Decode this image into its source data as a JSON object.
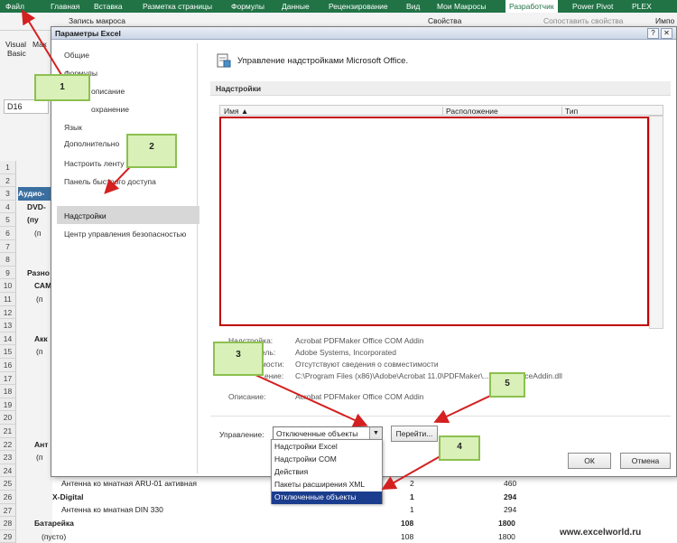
{
  "ribbon": {
    "tabs": [
      "Файл",
      "Главная",
      "Вставка",
      "Разметка страницы",
      "Формулы",
      "Данные",
      "Рецензирование",
      "Вид",
      "Мои Макросы",
      "Разработчик",
      "Power Pivot",
      "PLEX"
    ],
    "record_macro": "Запись макроса",
    "properties": "Свойства",
    "map_properties": "Сопоставить свойства",
    "import": "Импо",
    "vb_line1": "Visual",
    "vb_line2": "Basic",
    "macros": "Мак"
  },
  "sheet": {
    "name_box": "D16",
    "row_numbers": [
      "1",
      "2",
      "3",
      "4",
      "5",
      "6",
      "7",
      "8",
      "9",
      "10",
      "11",
      "12",
      "13",
      "14",
      "15",
      "16",
      "17",
      "18",
      "19",
      "20",
      "21",
      "22",
      "23",
      "24",
      "25",
      "26",
      "27",
      "28",
      "29"
    ],
    "left_labels": [
      "Аудио-",
      "DVD-",
      "(пу",
      "(п",
      "",
      "",
      "",
      "Разно",
      "САМ",
      "(п",
      "",
      "",
      "Акк",
      "(п",
      "",
      "",
      "",
      "",
      "",
      "",
      "Ант",
      "(п",
      "",
      "",
      "",
      "",
      ""
    ],
    "rows": [
      {
        "label": "Антенна ко мнатная  ARU-01 активная",
        "qty": "2",
        "sum": "460"
      },
      {
        "label": "X-Digital",
        "qty": "1",
        "sum": "294"
      },
      {
        "label": "Антенна ко мнатная  DIN 330",
        "qty": "1",
        "sum": "294"
      },
      {
        "label": "Батарейка",
        "qty": "108",
        "sum": "1800"
      },
      {
        "label": "(пусто)",
        "qty": "108",
        "sum": "1800"
      }
    ]
  },
  "dialog": {
    "title": "Параметры Excel",
    "help": "?",
    "close": "✕",
    "nav": [
      "Общие",
      "Формулы",
      "Правописание",
      "Сохранение",
      "Язык",
      "Дополнительно",
      "Настроить ленту",
      "Панель быстрого доступа",
      "Надстройки",
      "Центр управления безопасностью"
    ],
    "nav_shown": [
      "Общие",
      "Формулы",
      "описание",
      "охранение",
      "Язык",
      "Дополнительно",
      "Настроить ленту",
      "Панель быстрого доступа",
      "Надстройки",
      "Центр управления безопасностью"
    ],
    "header_title": "Управление надстройками Microsoft Office.",
    "section_title": "Надстройки",
    "columns": [
      "Имя ▲",
      "Расположение",
      "Тип"
    ],
    "details": {
      "addin_label": "Надстройка:",
      "addin_value": "Acrobat PDFMaker Office COM Addin",
      "publisher_label": "ель:",
      "publisher_value": "Adobe Systems, Incorporated",
      "compat_label": "мости:",
      "compat_value": "Отсутствуют сведения о совместимости",
      "location_label": "ение:",
      "location_value": "C:\\Program Files (x86)\\Adobe\\Acrobat 11.0\\PDFMaker\\...\\PDFMOfficeAddin.dll",
      "description_label": "Описание:",
      "description_value": "Acrobat PDFMaker Office COM Addin"
    },
    "manage_label": "Управление:",
    "manage_value": "Отключенные объекты",
    "go_button": "Перейти...",
    "ok_button": "ОК",
    "cancel_button": "Отмена",
    "dropdown_options": [
      "Надстройки Excel",
      "Надстройки COM",
      "Действия",
      "Пакеты расширения XML",
      "Отключенные объекты"
    ]
  },
  "callouts": [
    "1",
    "2",
    "3",
    "4",
    "5"
  ],
  "watermark": "www.excelworld.ru",
  "colors": {
    "ribbon": "#217346",
    "highlight": "#c00000",
    "callout_fill": "#d9f0b8",
    "selected_option": "#1b3d8e"
  }
}
